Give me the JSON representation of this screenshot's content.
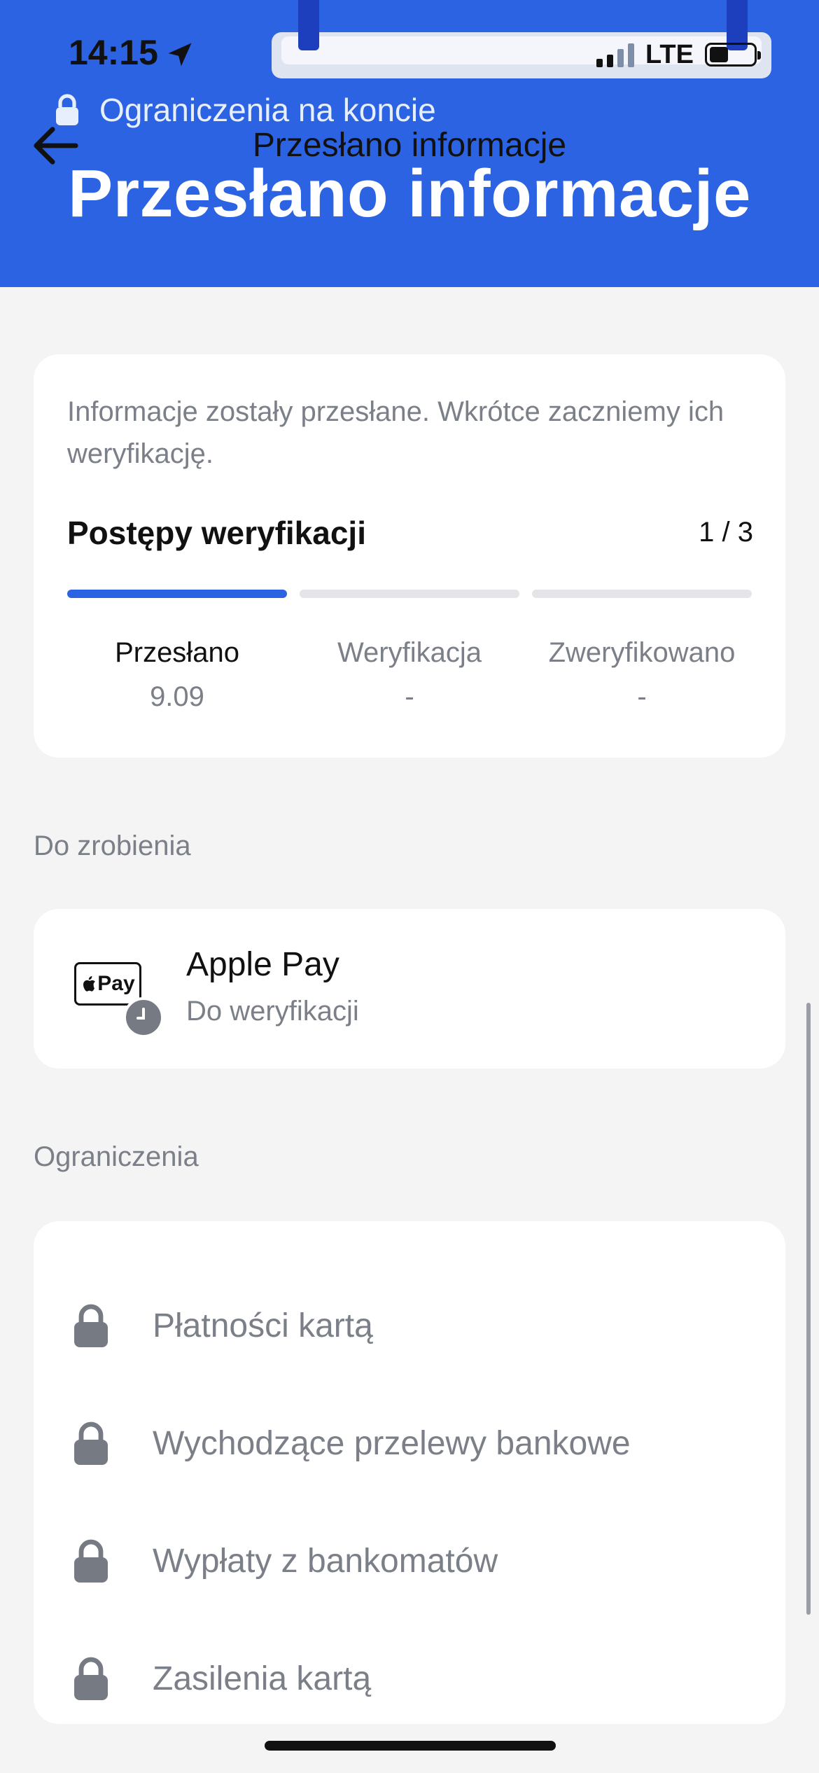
{
  "status_bar": {
    "time": "14:15",
    "network": "LTE"
  },
  "header": {
    "restriction_label": "Ograniczenia na koncie",
    "nav_title": "Przesłano informacje",
    "title": "Przesłano informacje",
    "background_color": "#2b63e3"
  },
  "progress_card": {
    "description": "Informacje zostały przesłane. Wkrótce zaczniemy ich weryfikację.",
    "title": "Postępy weryfikacji",
    "count": "1 / 3",
    "progress_fraction": 0.333,
    "steps": [
      {
        "name": "Przesłano",
        "value": "9.09"
      },
      {
        "name": "Weryfikacja",
        "value": "-"
      },
      {
        "name": "Zweryfikowano",
        "value": "-"
      }
    ]
  },
  "todo": {
    "section_label": "Do zrobienia",
    "item": {
      "badge": "Pay",
      "title": "Apple Pay",
      "subtitle": "Do weryfikacji"
    }
  },
  "limits": {
    "section_label": "Ograniczenia",
    "items": [
      {
        "label": "Płatności kartą",
        "icon": "lock-icon"
      },
      {
        "label": "Wychodzące przelewy bankowe",
        "icon": "lock-icon"
      },
      {
        "label": "Wypłaty z bankomatów",
        "icon": "lock-icon"
      },
      {
        "label": "Zasilenia kartą",
        "icon": "lock-icon"
      }
    ]
  }
}
